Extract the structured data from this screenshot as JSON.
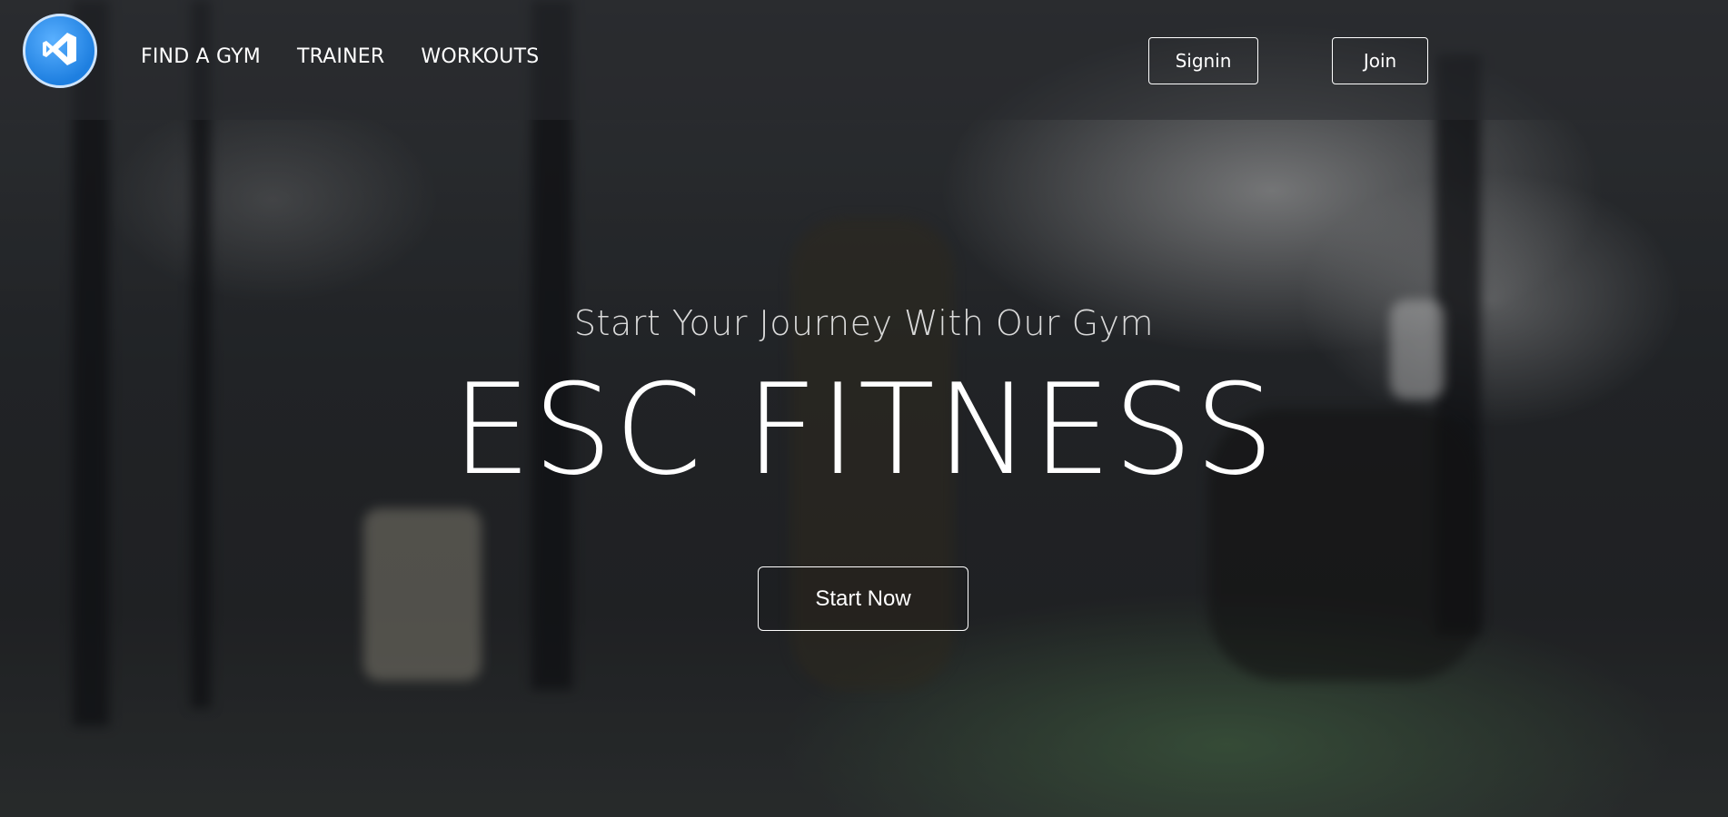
{
  "app": {
    "brand_color": "#1e7fe0",
    "logo_icon": "visual-studio-icon"
  },
  "nav": {
    "links": [
      {
        "label": "FIND A GYM"
      },
      {
        "label": "TRAINER"
      },
      {
        "label": "WORKOUTS"
      }
    ],
    "signin_label": "Signin",
    "join_label": "Join"
  },
  "hero": {
    "tagline": "Start Your Journey With Our Gym",
    "title": "ESC FITNESS",
    "cta_label": "Start Now"
  }
}
